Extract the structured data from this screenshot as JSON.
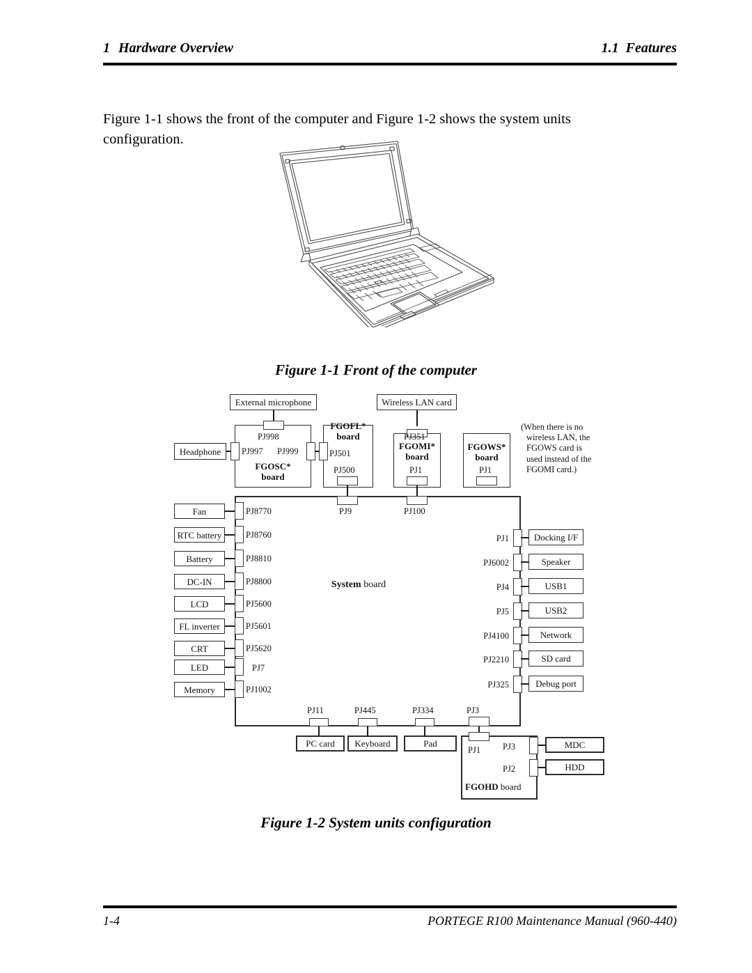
{
  "header": {
    "chapter_number": "1",
    "chapter_title": "Hardware Overview",
    "section_number": "1.1",
    "section_title": "Features"
  },
  "intro": {
    "paragraph": "Figure 1-1 shows the front of the computer and Figure 1-2 shows the system units configuration."
  },
  "figures": {
    "fig1_caption": "Figure 1-1 Front of the computer",
    "fig2_caption": "Figure 1-2 System units configuration"
  },
  "diagram": {
    "note": {
      "line1": "(When there is no",
      "line2": "wireless LAN, the",
      "line3": "FGOWS card is",
      "line4": "used instead of the",
      "line5": "FGOMI card.)"
    },
    "top_devices": {
      "external_microphone": "External microphone",
      "wireless_lan_card": "Wireless LAN card",
      "headphone": "Headphone"
    },
    "boards": {
      "fgosc": {
        "name": "FGOSC*",
        "suffix": "board"
      },
      "fgofl": {
        "name": "FGOFL*",
        "suffix": "board"
      },
      "fgomi": {
        "name": "FGOMI*",
        "suffix": "board"
      },
      "fgows": {
        "name": "FGOWS*",
        "suffix": "board"
      },
      "system": {
        "name": "System",
        "suffix": "board"
      },
      "fgohd": {
        "name": "FGOHD",
        "suffix": "board"
      }
    },
    "board_connectors": {
      "fgosc_top": "PJ998",
      "fgosc_left": "PJ997",
      "fgosc_right": "PJ999",
      "fgofl_left": "PJ501",
      "fgofl_bottom": "PJ500",
      "fgomi_top": "PJ351",
      "fgomi_bottom": "PJ1",
      "fgows_bottom": "PJ1",
      "system_top_left": "PJ9",
      "system_top_right": "PJ100",
      "fgohd_top": "PJ1",
      "fgohd_mdc": "PJ3",
      "fgohd_hdd": "PJ2"
    },
    "left_connections": [
      {
        "device": "Fan",
        "pj": "PJ8770"
      },
      {
        "device": "RTC battery",
        "pj": "PJ8760"
      },
      {
        "device": "Battery",
        "pj": "PJ8810"
      },
      {
        "device": "DC-IN",
        "pj": "PJ8800"
      },
      {
        "device": "LCD",
        "pj": "PJ5600"
      },
      {
        "device": "FL inverter",
        "pj": "PJ5601"
      },
      {
        "device": "CRT",
        "pj": "PJ5620"
      },
      {
        "device": "LED",
        "pj": "PJ7"
      },
      {
        "device": "Memory",
        "pj": "PJ1002"
      }
    ],
    "right_connections": [
      {
        "device": "Docking I/F",
        "pj": "PJ1"
      },
      {
        "device": "Speaker",
        "pj": "PJ6002"
      },
      {
        "device": "USB1",
        "pj": "PJ4"
      },
      {
        "device": "USB2",
        "pj": "PJ5"
      },
      {
        "device": "Network",
        "pj": "PJ4100"
      },
      {
        "device": "SD card",
        "pj": "PJ2210"
      },
      {
        "device": "Debug port",
        "pj": "PJ325"
      }
    ],
    "bottom_connections": [
      {
        "device": "PC card",
        "pj": "PJ11"
      },
      {
        "device": "Keyboard",
        "pj": "PJ445"
      },
      {
        "device": "Pad",
        "pj": "PJ334"
      },
      {
        "device": "FGOHD",
        "pj": "PJ3"
      }
    ],
    "fgohd_devices": [
      {
        "device": "MDC",
        "pj": "PJ3"
      },
      {
        "device": "HDD",
        "pj": "PJ2"
      }
    ]
  },
  "footer": {
    "page_number": "1-4",
    "manual_title": "PORTEGE R100 Maintenance Manual (960-440)"
  },
  "colors": {
    "rule": "#000000",
    "box_border": "#2b2b2b",
    "wire": "#1a1a1a",
    "text": "#000000"
  }
}
